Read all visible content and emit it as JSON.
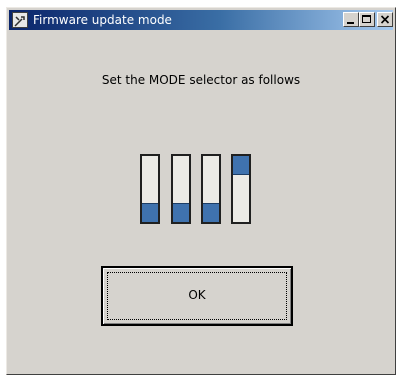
{
  "window": {
    "title": "Firmware update mode",
    "app_icon": "app-icon",
    "controls": [
      "minimize-icon",
      "maximize-icon",
      "close-icon"
    ]
  },
  "content": {
    "instruction": "Set the MODE selector as follows",
    "mode_selector": {
      "switches": [
        {
          "position": "down"
        },
        {
          "position": "down"
        },
        {
          "position": "down"
        },
        {
          "position": "up"
        }
      ],
      "knob_color": "#3f72ae"
    },
    "ok_button_label": "OK"
  },
  "colors": {
    "title_bar_start": "#0a246a",
    "title_bar_end": "#a6caf0",
    "window_bg": "#d6d3ce"
  }
}
